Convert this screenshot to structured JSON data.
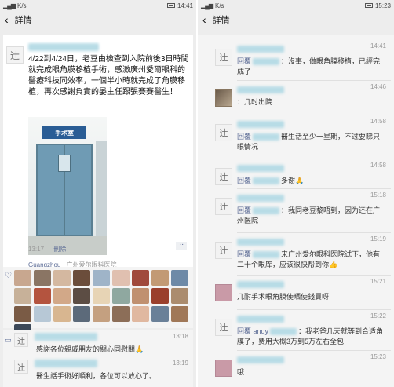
{
  "left": {
    "status_time": "14:41",
    "status_net": "K/s",
    "nav_title": "詳情",
    "post": {
      "text": "4/22到4/24日，老豆由檢查到入院前後3日時間就完成眼角膜移植手術，感激廣州愛爾眼科的醫療科技同效率，一個半小時就完成了角膜移植，再次感謝負責的晏主任跟張賽賽醫生！",
      "photo_sign": "手术室",
      "location": "Guangzhou",
      "location_sub": "· 广州爱尔眼科医院",
      "time": "13:17",
      "delete": "刪除",
      "more": "··"
    },
    "like_colors": [
      "#c8a78f",
      "#8a7564",
      "#d4b8a0",
      "#6b4d3b",
      "#9fb4c8",
      "#e0c0b0",
      "#a0493c",
      "#c29a74",
      "#6e8aa7",
      "#c7b199",
      "#b4543f",
      "#d2a888",
      "#5c4d44",
      "#e7d4b5",
      "#8fa8a0",
      "#c09070",
      "#9a3f2c",
      "#ab8c6e",
      "#7a5b45",
      "#b7c8d6",
      "#d8b690",
      "#5c6a7a",
      "#c4a080",
      "#8c6e58",
      "#e0b8a0",
      "#6a8098",
      "#a07858",
      "#3c4858"
    ],
    "comments": [
      {
        "time": "13:18",
        "text": "感謝各位親戚朋友的關心同慰問🙏"
      },
      {
        "time": "13:19",
        "text": "醫生話手術好順利，各位可以放心了。"
      }
    ]
  },
  "right": {
    "status_time": "15:23",
    "status_net": "K/s",
    "nav_title": "詳情",
    "items": [
      {
        "time": "14:41",
        "avatar": "辻",
        "avatar_style": "",
        "prefix": "回覆",
        "text": "：沒事，做眼角膜移植，已經完成了"
      },
      {
        "time": "14:46",
        "avatar": "",
        "avatar_style": "photo",
        "prefix": "",
        "text": "：几时出院"
      },
      {
        "time": "14:58",
        "avatar": "辻",
        "avatar_style": "",
        "prefix": "回覆",
        "text": "醫生话至少一星期，不过要睇只眼情况"
      },
      {
        "time": "14:58",
        "avatar": "辻",
        "avatar_style": "",
        "prefix": "回覆",
        "text": "多谢🙏"
      },
      {
        "time": "15:18",
        "avatar": "辻",
        "avatar_style": "",
        "prefix": "回覆",
        "text": "：我同老豆黎唔到，因为还在广州医院"
      },
      {
        "time": "15:19",
        "avatar": "辻",
        "avatar_style": "",
        "prefix": "回覆",
        "text": "来广州爱尔眼科医院试下，他有二十个眼库，应该很快帮到你👍"
      },
      {
        "time": "15:21",
        "avatar": "",
        "avatar_style": "pink",
        "prefix": "",
        "text": "几耐手术眼角膜使晒使錢買呀"
      },
      {
        "time": "15:22",
        "avatar": "辻",
        "avatar_style": "",
        "prefix": "回覆 andy",
        "text": "：我老爸几天就等到合适角膜了，费用大概3万到5万左右全包"
      },
      {
        "time": "15:23",
        "avatar": "",
        "avatar_style": "pink",
        "prefix": "",
        "text": "哦"
      }
    ]
  }
}
